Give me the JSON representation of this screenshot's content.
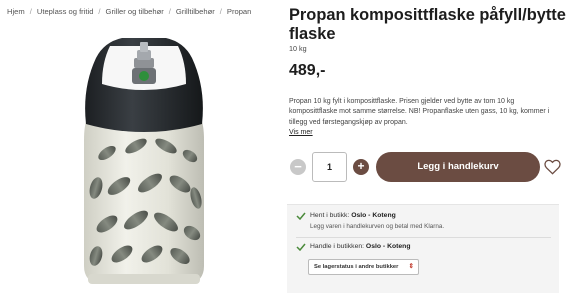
{
  "breadcrumb": {
    "items": [
      "Hjem",
      "Uteplass og fritid",
      "Griller og tilbehør",
      "Grilltilbehør",
      "Propan"
    ],
    "separator": "/"
  },
  "product": {
    "title": "Propan komposittflaske påfyll/bytte flaske",
    "subtitle": "10 kg",
    "price": "489,-",
    "description": "Propan 10 kg fylt i komposittflaske. Prisen gjelder ved bytte av tom 10 kg komposittflaske mot samme størrelse. NB! Propanflaske uten gass, 10 kg, kommer i tillegg ved førstegangskjøp av propan.",
    "more_link": "Vis mer"
  },
  "cart": {
    "minus_label": "−",
    "quantity": "1",
    "plus_label": "+",
    "add_label": "Legg i handlekurv"
  },
  "availability": {
    "pickup_label": "Hent i butikk:",
    "pickup_store": "Oslo - Koteng",
    "pickup_sub": "Legg varen i handlekurven og betal med Klarna.",
    "instore_label": "Handle i butikken:",
    "instore_store": "Oslo - Koteng",
    "stock_select": "Se lagerstatus i andre butikker"
  },
  "colors": {
    "accent": "#6b4c42",
    "check": "#4a8a3a"
  },
  "icons": {
    "wishlist": "heart-icon",
    "check": "checkmark-icon",
    "dropdown": "chevron-updown-icon"
  }
}
